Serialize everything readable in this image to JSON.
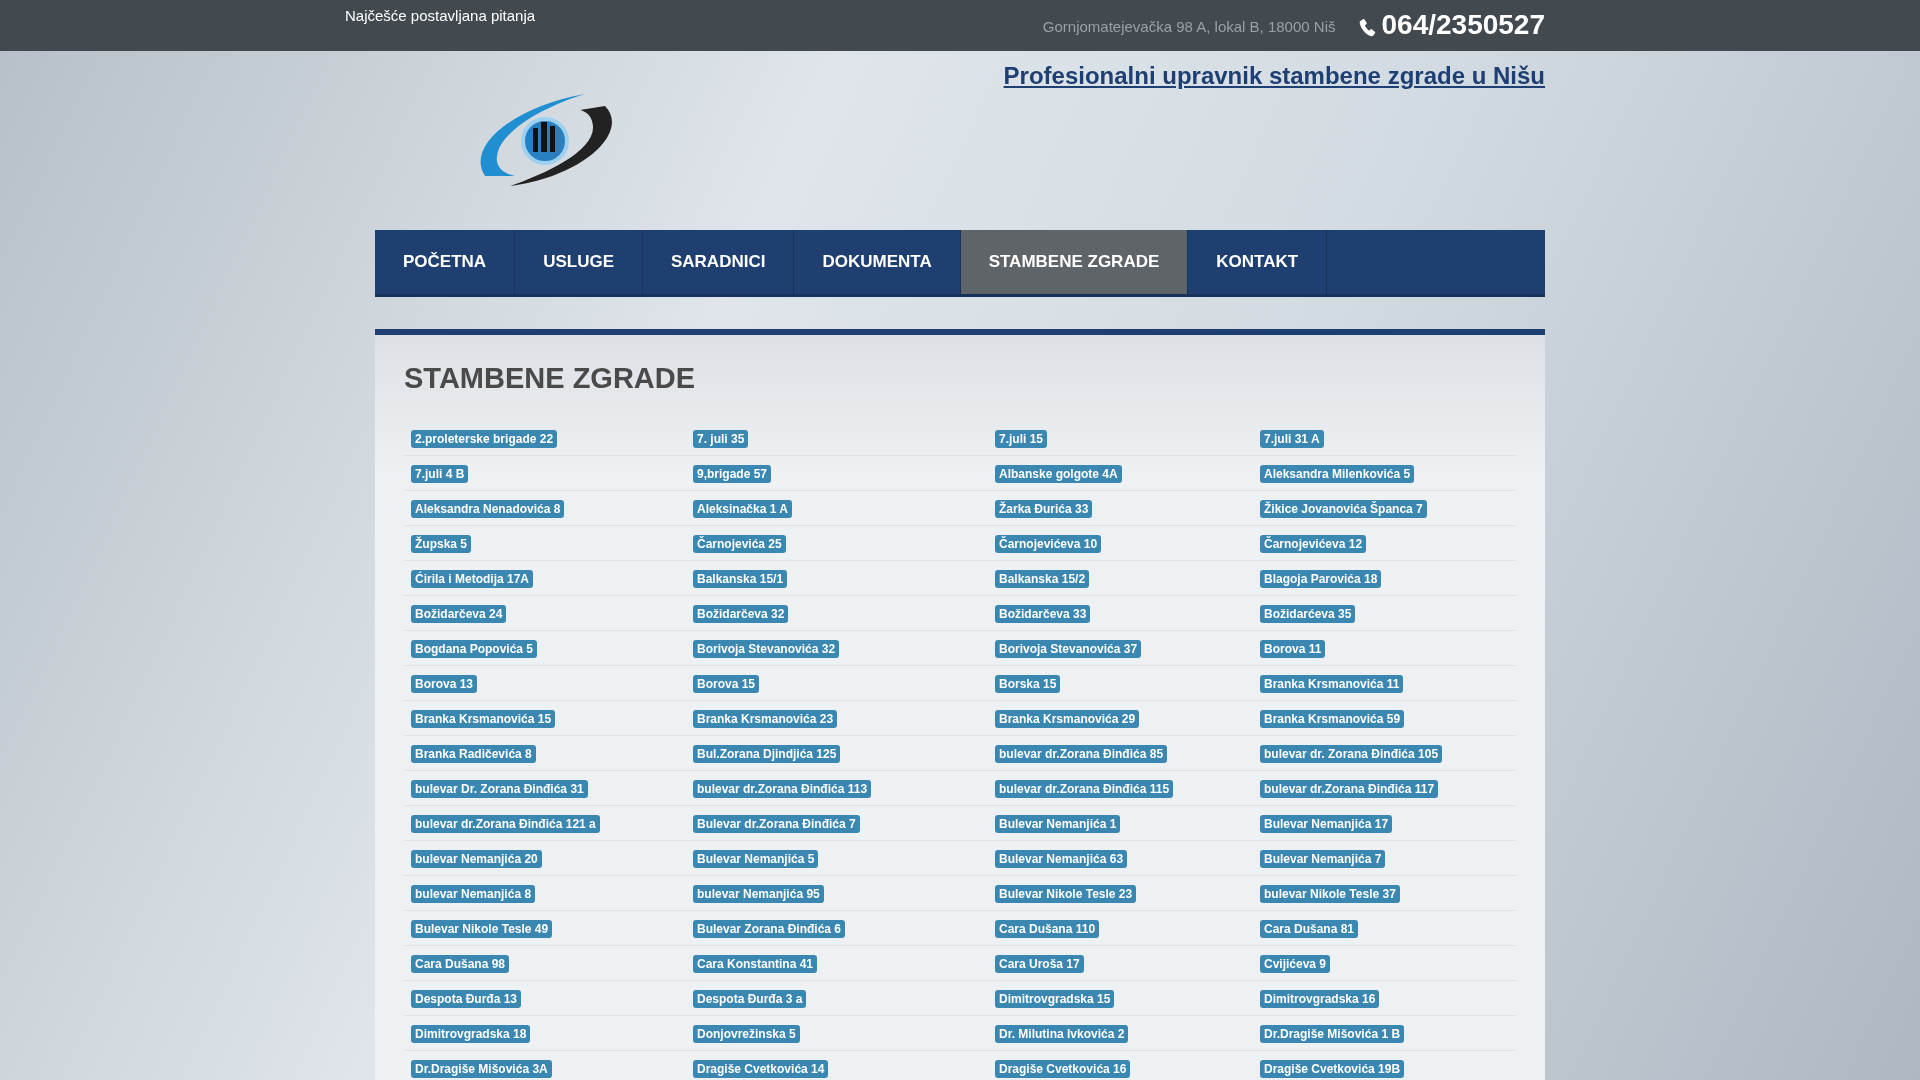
{
  "top_bar": {
    "faq_link": "Najčešće postavljana pitanja",
    "address": "Gornjomatejevačka 98 A, lokal B, 18000 Niš",
    "phone": "064/2350527"
  },
  "tagline": "Profesionalni upravnik stambene zgrade u Nišu",
  "nav": [
    {
      "label": "POČETNA",
      "selected": false
    },
    {
      "label": "USLUGE",
      "selected": false
    },
    {
      "label": "SARADNICI",
      "selected": false
    },
    {
      "label": "DOKUMENTA",
      "selected": false
    },
    {
      "label": "STAMBENE ZGRADE",
      "selected": true
    },
    {
      "label": "KONTAKT",
      "selected": false
    }
  ],
  "page_title": "STAMBENE ZGRADE",
  "buildings": [
    [
      "2.proleterske brigade 22",
      "7. juli 35",
      "7.juli 15",
      "7.juli 31 A"
    ],
    [
      "7.juli 4 B",
      "9,brigade 57",
      "Albanske golgote 4A",
      "Aleksandra Milenkovića 5"
    ],
    [
      "Aleksandra Nenadovića 8",
      "Aleksinačka 1 A",
      "Žarka Đurića 33",
      "Žikice Jovanovića Španca 7"
    ],
    [
      "Župska 5",
      "Čarnojevića 25",
      "Čarnojevićeva 10",
      "Čarnojevićeva 12"
    ],
    [
      "Ćirila i Metodija 17A",
      "Balkanska 15/1",
      "Balkanska 15/2",
      "Blagoja Parovića 18"
    ],
    [
      "Božidarčeva 24",
      "Božidarčeva 32",
      "Božidarčeva 33",
      "Božidarćeva 35"
    ],
    [
      "Bogdana Popovića 5",
      "Borivoja Stevanovića 32",
      "Borivoja Stevanovića 37",
      "Borova 11"
    ],
    [
      "Borova 13",
      "Borova 15",
      "Borska 15",
      "Branka Krsmanovića 11"
    ],
    [
      "Branka Krsmanovića 15",
      "Branka Krsmanovića 23",
      "Branka Krsmanovića 29",
      "Branka Krsmanovića 59"
    ],
    [
      "Branka Radičevića 8",
      "Bul.Zorana Djindjića 125",
      "bulevar dr.Zorana Đinđića 85",
      "bulevar dr. Zorana Đinđića 105"
    ],
    [
      "bulevar Dr. Zorana Đinđića 31",
      "bulevar dr.Zorana Đinđića 113",
      "bulevar dr.Zorana Đinđića 115",
      "bulevar dr.Zorana Đinđića 117"
    ],
    [
      "bulevar dr.Zorana Đinđića 121 a",
      "Bulevar dr.Zorana Đinđića 7",
      "Bulevar Nemanjića 1",
      "Bulevar Nemanjića 17"
    ],
    [
      "bulevar Nemanjića 20",
      "Bulevar Nemanjića 5",
      "Bulevar Nemanjića 63",
      "Bulevar Nemanjića 7"
    ],
    [
      "bulevar Nemanjića 8",
      "bulevar Nemanjića 95",
      "Bulevar Nikole Tesle 23",
      "bulevar Nikole Tesle 37"
    ],
    [
      "Bulevar Nikole Tesle 49",
      "Bulevar Zorana Đinđića 6",
      "Cara Dušana 110",
      "Cara Dušana 81"
    ],
    [
      "Cara Dušana 98",
      "Cara Konstantina 41",
      "Cara Uroša 17",
      "Cvijićeva 9"
    ],
    [
      "Despota Đurđa 13",
      "Despota Đurđa 3 a",
      "Dimitrovgradska 15",
      "Dimitrovgradska 16"
    ],
    [
      "Dimitrovgradska 18",
      "Donjovrežinska 5",
      "Dr. Milutina Ivkovića 2",
      "Dr.Dragiše Mišovića 1 B"
    ],
    [
      "Dr.Dragiše Mišovića 3A",
      "Dragiše Cvetkovića 14",
      "Dragiše Cvetkovića 16",
      "Dragiše Cvetkovića 19B"
    ]
  ]
}
